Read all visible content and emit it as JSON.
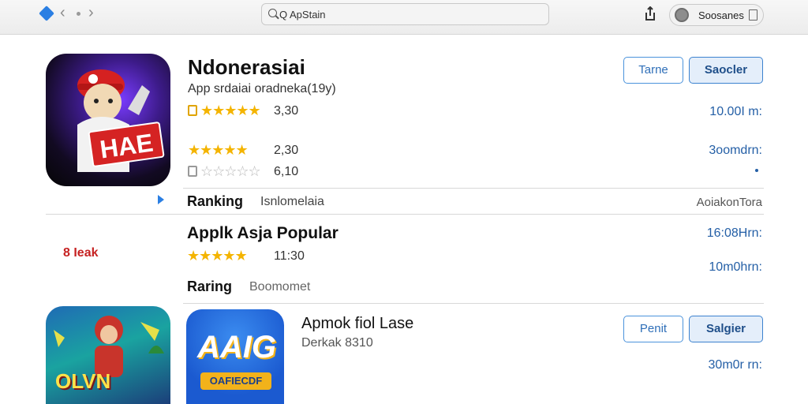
{
  "toolbar": {
    "search_text": "Q ApStain",
    "account_label": "Soosanes",
    "icons": [
      "back-chevron-icon",
      "forward-chevron-icon",
      "search-icon",
      "share-icon",
      "account-icon",
      "menu-icon"
    ]
  },
  "app1": {
    "icon_text": "HAE",
    "title": "Ndonerasiai",
    "subtitle": "App srdaiai oradneka(19y)",
    "rating1": "3,30",
    "rating2": "2,30",
    "rating3": "6,10",
    "stars_filled_1": 5,
    "stars_filled_2": 5,
    "stars_filled_3": 0,
    "btn_secondary": "Tarne",
    "btn_primary": "Saocler",
    "price1": "10.00I m:",
    "price2": "3oomdrn:"
  },
  "ranking_row": {
    "label": "Ranking",
    "value": "Isnlomelaia",
    "right_text": "AoiakonTora"
  },
  "section2": {
    "logo_text": "8 Ieak",
    "title": "Applk Asja Popular",
    "rating": "11:30",
    "stars_filled": 5,
    "price1": "16:08Hrn:",
    "price2": "10m0hrn:",
    "sub_label": "Raring",
    "sub_value": "Boomomet"
  },
  "app3": {
    "icon2_text": "OLVN",
    "icon3_text": "AAIG",
    "icon3_banner": "OAFIECDF",
    "title": "Apmok fiol Lase",
    "subtitle": "Derkak 8310",
    "btn_secondary": "Penit",
    "btn_primary": "Salgier",
    "price": "30m0r rn:"
  },
  "colors": {
    "accent": "#2f6fb8",
    "star": "#f4b400",
    "price": "#245fa6"
  }
}
